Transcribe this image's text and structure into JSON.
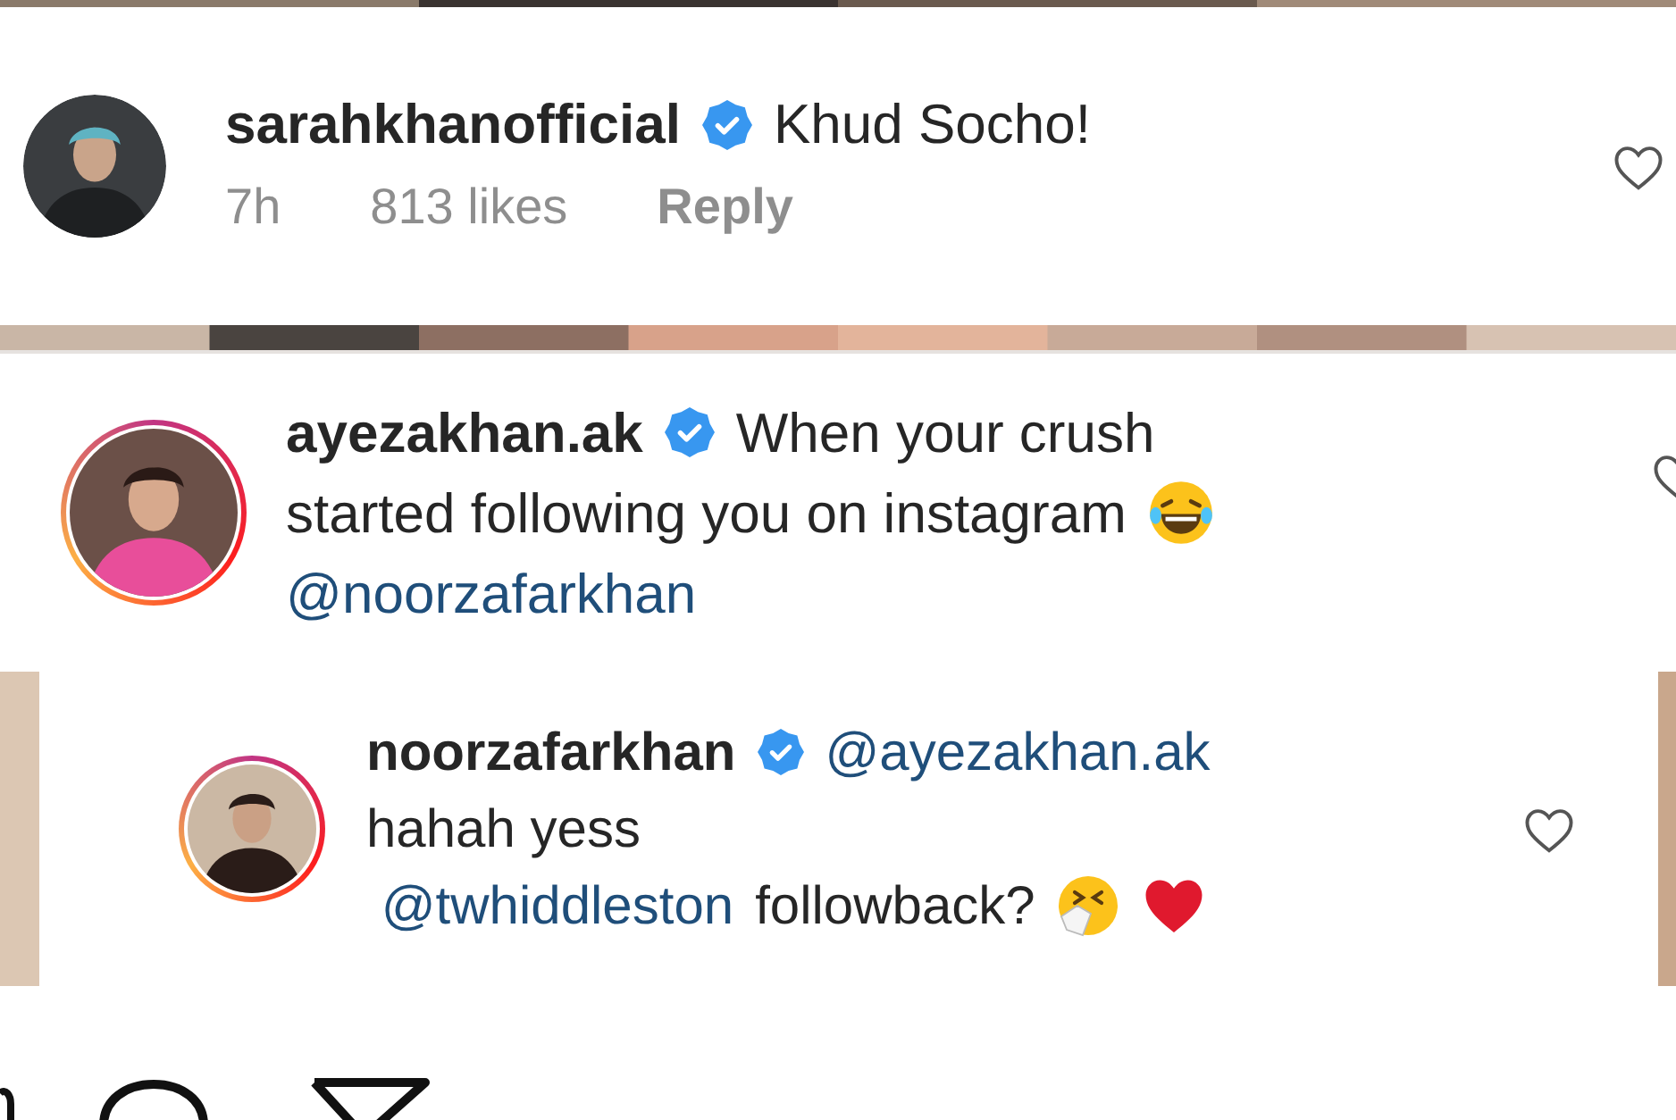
{
  "comments": [
    {
      "username": "sarahkhanofficial",
      "verified": true,
      "lines": [
        [
          {
            "kind": "text",
            "text": "Khud Socho!"
          }
        ]
      ],
      "meta": {
        "time": "7h",
        "likes": "813 likes",
        "reply": "Reply"
      }
    },
    {
      "username": "ayezakhan.ak",
      "verified": true,
      "lines": [
        [
          {
            "kind": "text",
            "text": "When your crush"
          }
        ],
        [
          {
            "kind": "text",
            "text": "started following you on instagram"
          },
          {
            "kind": "laughing-emoji"
          }
        ],
        [
          {
            "kind": "mention",
            "text": "@noorzafarkhan"
          }
        ]
      ]
    },
    {
      "username": "noorzafarkhan",
      "verified": true,
      "lines": [
        [
          {
            "kind": "mention",
            "text": "@ayezakhan.ak"
          }
        ],
        [
          {
            "kind": "text",
            "text": "hahah yess"
          }
        ],
        [
          {
            "kind": "mention",
            "text": " @twhiddleston"
          },
          {
            "kind": "text",
            "text": "followback?"
          },
          {
            "kind": "sneezing-emoji"
          },
          {
            "kind": "heart-emoji"
          }
        ]
      ]
    }
  ]
}
